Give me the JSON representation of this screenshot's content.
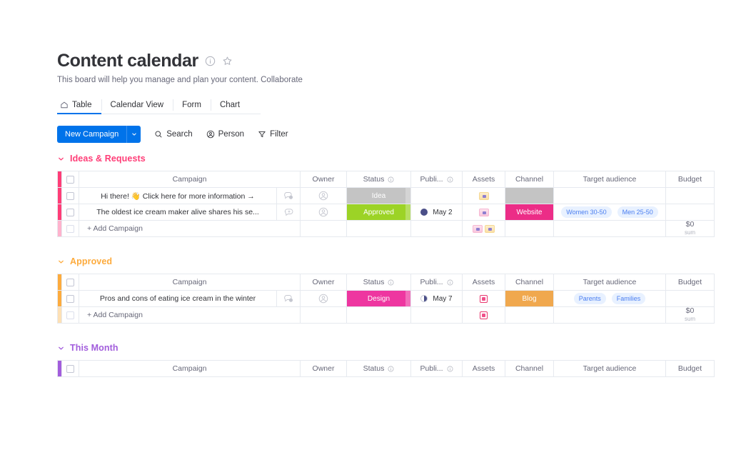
{
  "header": {
    "title": "Content calendar",
    "subtitle": "This board will help you manage and plan your content. Collaborate",
    "info_icon": "info-circle-icon",
    "star_icon": "star-icon"
  },
  "tabs": [
    {
      "label": "Table",
      "icon": "home-icon",
      "active": true
    },
    {
      "label": "Calendar View",
      "icon": "",
      "active": false
    },
    {
      "label": "Form",
      "icon": "",
      "active": false
    },
    {
      "label": "Chart",
      "icon": "",
      "active": false
    }
  ],
  "toolbar": {
    "new_campaign_label": "New Campaign",
    "caret_icon": "chevron-down-icon",
    "items": [
      {
        "label": "Search",
        "icon": "search-icon"
      },
      {
        "label": "Person",
        "icon": "person-icon"
      },
      {
        "label": "Filter",
        "icon": "filter-icon"
      }
    ]
  },
  "columns": {
    "campaign": "Campaign",
    "owner": "Owner",
    "status": "Status",
    "published": "Publi...",
    "assets": "Assets",
    "channel": "Channel",
    "target_audience": "Target audience",
    "budget": "Budget"
  },
  "colors": {
    "accent_blue": "#0073ea",
    "group_ideas": "#ff3d77",
    "group_approved": "#fdab3d",
    "group_this_month": "#a25ddc",
    "status_idea": "#c4c4c4",
    "status_approved": "#9cd326",
    "status_design": "#ee36a0",
    "channel_website": "#ec2d87",
    "channel_blog": "#f0a84e",
    "pill_bg": "#e8f1ff",
    "pill_text": "#4a7ef0"
  },
  "groups": [
    {
      "name": "Ideas & Requests",
      "color": "#ff3d77",
      "add_label": "+ Add Campaign",
      "budget_sum_value": "$0",
      "budget_sum_label": "sum",
      "rows": [
        {
          "campaign": "Hi there! 👋 Click here for more information →",
          "bubble_icon": "comment-badge-icon",
          "bubble_count": "1",
          "owner_icon": "avatar-placeholder-icon",
          "status": "Idea",
          "status_color": "#c4c4c4",
          "published": "",
          "published_dot": "",
          "assets": [
            "cream"
          ],
          "channel": "",
          "channel_color": "#c4c4c4",
          "audience": []
        },
        {
          "campaign": "The oldest ice cream maker alive shares his se...",
          "bubble_icon": "comment-add-icon",
          "bubble_count": "",
          "owner_icon": "avatar-placeholder-icon",
          "status": "Approved",
          "status_color": "#9cd326",
          "published": "May 2",
          "published_dot": "full",
          "assets": [
            "pink"
          ],
          "channel": "Website",
          "channel_color": "#ec2d87",
          "audience": [
            "Women 30-50",
            "Men 25-50"
          ]
        }
      ],
      "add_row_assets": [
        "pink",
        "cream"
      ]
    },
    {
      "name": "Approved",
      "color": "#fdab3d",
      "add_label": "+ Add Campaign",
      "budget_sum_value": "$0",
      "budget_sum_label": "sum",
      "rows": [
        {
          "campaign": "Pros and cons of eating ice cream in the winter",
          "bubble_icon": "comment-badge-icon",
          "bubble_count": "1",
          "owner_icon": "avatar-placeholder-icon",
          "status": "Design",
          "status_color": "#ee36a0",
          "published": "May 7",
          "published_dot": "half",
          "assets": [
            "square"
          ],
          "channel": "Blog",
          "channel_color": "#f0a84e",
          "audience": [
            "Parents",
            "Families"
          ]
        }
      ],
      "add_row_assets": [
        "square"
      ]
    },
    {
      "name": "This Month",
      "color": "#a25ddc",
      "add_label": "",
      "budget_sum_value": "",
      "budget_sum_label": "",
      "rows": [],
      "add_row_assets": []
    }
  ]
}
